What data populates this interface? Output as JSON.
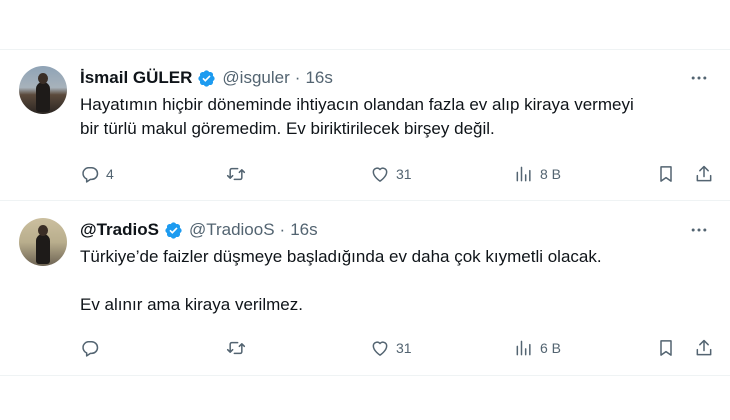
{
  "tweets": [
    {
      "name": "İsmail GÜLER",
      "handle": "@isguler",
      "separator": "·",
      "time": "16s",
      "text_lines": [
        "Hayatımın hiçbir döneminde ihtiyacın olandan fazla ev alıp kiraya vermeyi",
        "bir türlü makul göremedim. Ev biriktirilecek birşey değil."
      ],
      "replies": "4",
      "retweets": "",
      "likes": "31",
      "views": "8 B"
    },
    {
      "name": "@TradioS",
      "handle": "@TradiooS",
      "separator": "·",
      "time": "16s",
      "text_lines": [
        "Türkiye’de faizler düşmeye başladığında ev daha çok kıymetli olacak.",
        "Ev alınır ama kiraya verilmez."
      ],
      "replies": "",
      "retweets": "",
      "likes": "31",
      "views": "6 B"
    }
  ],
  "icons": {
    "verified": "verified-badge-icon",
    "more": "more-icon",
    "reply": "reply-icon",
    "retweet": "retweet-icon",
    "like": "heart-icon",
    "views": "views-icon",
    "bookmark": "bookmark-icon",
    "share": "share-icon"
  },
  "colors": {
    "verified": "#1d9bf0",
    "text": "#0f1419",
    "secondary": "#536471",
    "divider": "#eff3f4"
  }
}
